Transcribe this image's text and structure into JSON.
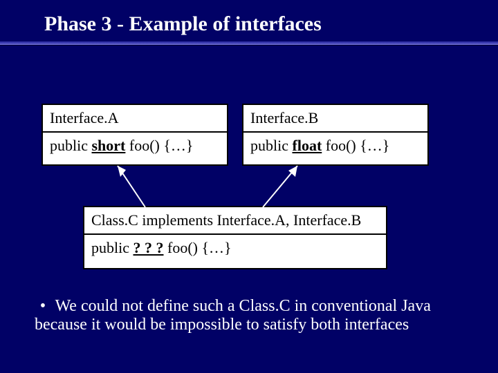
{
  "title": "Phase 3 - Example of interfaces",
  "interfaceA": {
    "header": "Interface.A",
    "method_prefix": "public ",
    "method_type": "short",
    "method_suffix": " foo() {…}"
  },
  "interfaceB": {
    "header": "Interface.B",
    "method_prefix": "public ",
    "method_type": "float",
    "method_suffix": " foo() {…}"
  },
  "classC": {
    "header": "Class.C implements Interface.A, Interface.B",
    "method_prefix": "public ",
    "method_type": "? ? ?",
    "method_suffix": " foo() {…}"
  },
  "bullet": {
    "marker": "•",
    "text": "We could not define such a Class.C in conventional Java because it would be impossible to satisfy both interfaces"
  }
}
